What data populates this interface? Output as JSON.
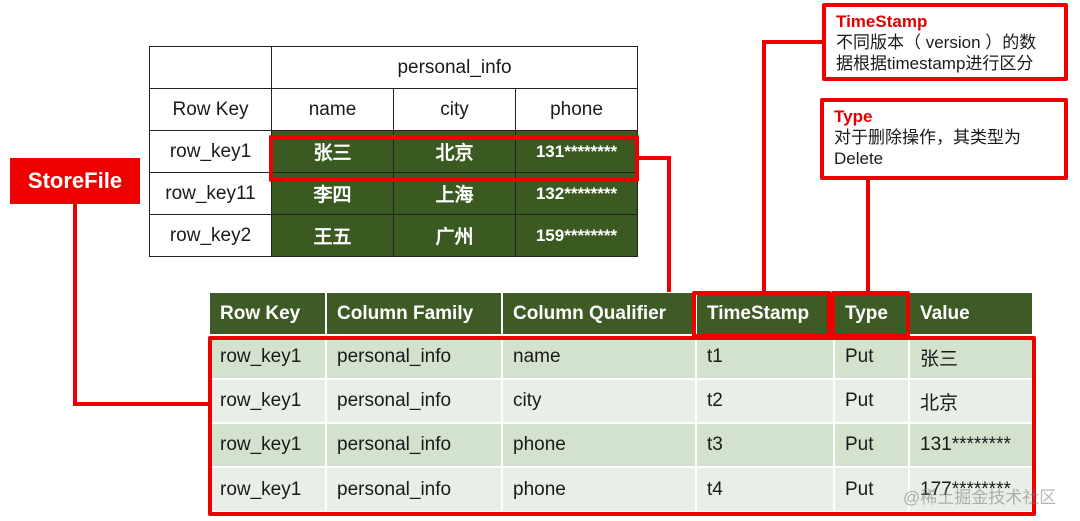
{
  "logical_table": {
    "column_family": "personal_info",
    "headers": [
      "Row Key",
      "name",
      "city",
      "phone"
    ],
    "rows": [
      {
        "row_key": "row_key1",
        "name": "张三",
        "city": "北京",
        "phone": "131********"
      },
      {
        "row_key": "row_key11",
        "name": "李四",
        "city": "上海",
        "phone": "132********"
      },
      {
        "row_key": "row_key2",
        "name": "王五",
        "city": "广州",
        "phone": "159********"
      }
    ]
  },
  "storefile_label": "StoreFile",
  "storefile_table": {
    "headers": [
      "Row Key",
      "Column Family",
      "Column Qualifier",
      "TimeStamp",
      "Type",
      "Value"
    ],
    "rows": [
      [
        "row_key1",
        "personal_info",
        "name",
        "t1",
        "Put",
        "张三"
      ],
      [
        "row_key1",
        "personal_info",
        "city",
        "t2",
        "Put",
        "北京"
      ],
      [
        "row_key1",
        "personal_info",
        "phone",
        "t3",
        "Put",
        "131********"
      ],
      [
        "row_key1",
        "personal_info",
        "phone",
        "t4",
        "Put",
        "177********"
      ]
    ]
  },
  "notes": {
    "timestamp": {
      "title": "TimeStamp",
      "line1": "不同版本（ version ）的数",
      "line2": "据根据timestamp进行区分"
    },
    "type": {
      "title": "Type",
      "line1": "对于删除操作，其类型为",
      "line2": "Delete"
    }
  },
  "watermark": "@稀土掘金技术社区",
  "colors": {
    "highlight": "#ee0000",
    "header_green": "#3f5b25",
    "row_odd": "#d3e2cd",
    "row_even": "#e9efe6"
  }
}
